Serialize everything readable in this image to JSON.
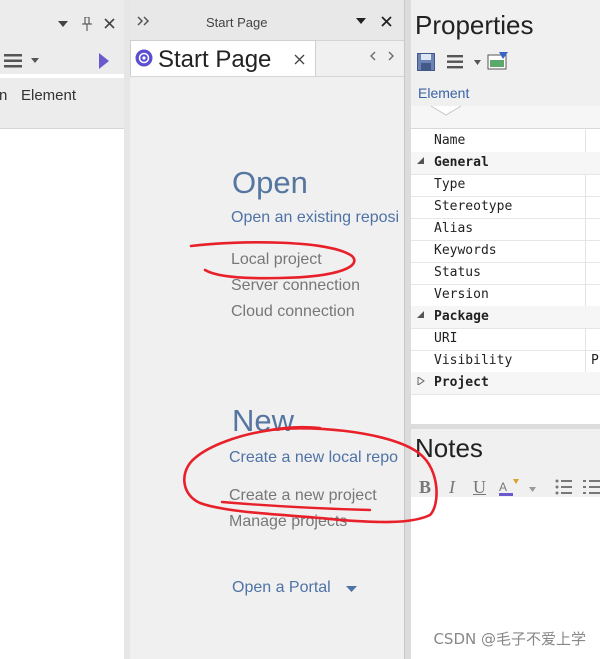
{
  "left_panel": {
    "tab_element": "Element",
    "tab_partial": "n"
  },
  "start_page": {
    "header_title": "Start Page",
    "tab_title": "Start Page",
    "open": {
      "heading": "Open",
      "link": "Open an existing reposi",
      "items": [
        "Local project",
        "Server connection",
        "Cloud connection"
      ]
    },
    "new": {
      "heading": "New",
      "link": "Create a new local repo",
      "items": [
        "Create a new project",
        "Manage projects"
      ]
    },
    "portal": "Open a Portal"
  },
  "properties": {
    "title": "Properties",
    "tab": "Element",
    "rows": [
      {
        "label": "Name",
        "category": false
      },
      {
        "label": "General",
        "category": true,
        "expanded": true
      },
      {
        "label": "Type",
        "category": false
      },
      {
        "label": "Stereotype",
        "category": false
      },
      {
        "label": "Alias",
        "category": false
      },
      {
        "label": "Keywords",
        "category": false
      },
      {
        "label": "Status",
        "category": false
      },
      {
        "label": "Version",
        "category": false
      },
      {
        "label": "Package",
        "category": true,
        "expanded": true
      },
      {
        "label": "URI",
        "category": false
      },
      {
        "label": "Visibility",
        "category": false,
        "value": "Pu"
      },
      {
        "label": "Project",
        "category": true,
        "expanded": false
      }
    ]
  },
  "notes": {
    "title": "Notes",
    "toolbar": {
      "bold": "B",
      "italic": "I",
      "underline": "U"
    }
  },
  "watermark": "CSDN @毛子不爱上学",
  "colors": {
    "accent": "#5576a0",
    "annotation": "#e8202a",
    "arrow": "#6a5acd"
  }
}
